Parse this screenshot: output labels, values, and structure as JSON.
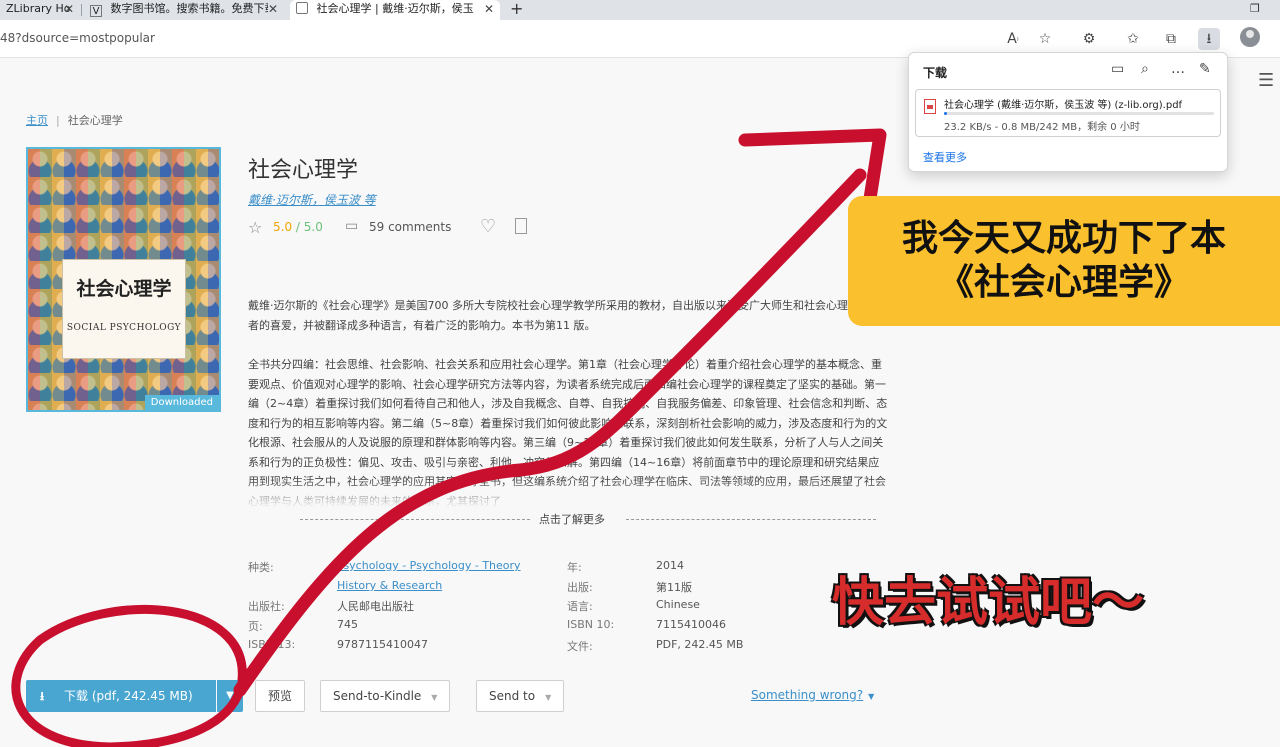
{
  "browser": {
    "tabs": [
      {
        "title": "ZLibrary Ho",
        "favicon": "z-icon"
      },
      {
        "title": "数字图书馆。搜索书籍。免费下载",
        "favicon": "v-icon"
      },
      {
        "title": "社会心理学 | 戴维·迈尔斯，侯玉",
        "favicon": "page-icon"
      }
    ],
    "address": "48?dsource=mostpopular",
    "icons": [
      "read-aloud-icon",
      "favorite-add-icon",
      "extensions-icon",
      "favorites-icon",
      "collections-icon",
      "download-icon",
      "profile-icon"
    ]
  },
  "downloads_panel": {
    "title": "下载",
    "file_name": "社会心理学 (戴维·迈尔斯，侯玉波 等) (z-lib.org).pdf",
    "status": "23.2 KB/s - 0.8 MB/242 MB，剩余 0 小时",
    "progress": 0.0035,
    "see_more": "查看更多"
  },
  "breadcrumb": {
    "home": "主页",
    "current": "社会心理学"
  },
  "cover": {
    "title_cn": "社会心理学",
    "title_en": "SOCIAL PSYCHOLOGY",
    "badge": "Downloaded"
  },
  "book": {
    "title": "社会心理学",
    "authors": "戴维·迈尔斯，侯玉波 等",
    "rating": "5.0",
    "rating_max": "/ 5.0",
    "comments": "59 comments",
    "description_p1": "戴维·迈尔斯的《社会心理学》是美国700 多所大专院校社会心理学教学所采用的教材，自出版以来深受广大师生和社会心理学爱好者的喜爱，并被翻译成多种语言，有着广泛的影响力。本书为第11 版。",
    "description_p2": "全书共分四编：社会思维、社会影响、社会关系和应用社会心理学。第1章（社会心理学导论）着重介绍社会心理学的基本概念、重要观点、价值观对心理学的影响、社会心理学研究方法等内容，为读者系统完成后面四编社会心理学的课程奠定了坚实的基础。第一编（2~4章）着重探讨我们如何看待自己和他人，涉及自我概念、自尊、自我控制、自我服务偏差、印象管理、社会信念和判断、态度和行为的相互影响等内容。第二编（5~8章）着重探讨我们如何彼此影响和联系，深刻剖析社会影响的威力，涉及态度和行为的文化根源、社会服从的人及说服的原理和群体影响等内容。第三编（9~13章）着重探讨我们彼此如何发生联系，分析了人与人之间关系和行为的正负极性：偏见、攻击、吸引与亲密、利他、冲突与和解。第四编（14~16章）将前面章节中的理论原理和研究结果应用到现实生活之中，社会心理学的应用其实贯穿全书，但这编系统介绍了社会心理学在临床、司法等领域的应用，最后还展望了社会心理学与人类可持续发展的未来的关系，尤其探讨了",
    "more": "点击了解更多"
  },
  "meta": {
    "category_label": "种类:",
    "category_1": "Psychology - Psychology - Theory",
    "category_2": "History & Research",
    "publisher_label": "出版社:",
    "publisher": "人民邮电出版社",
    "pages_label": "页:",
    "pages": "745",
    "isbn13_label": "ISBN 13:",
    "isbn13": "9787115410047",
    "year_label": "年:",
    "year": "2014",
    "edition_label": "出版:",
    "edition": "第11版",
    "language_label": "语言:",
    "language": "Chinese",
    "isbn10_label": "ISBN 10:",
    "isbn10": "7115410046",
    "file_label": "文件:",
    "file": "PDF, 242.45 MB"
  },
  "actions": {
    "download": "下载 (pdf, 242.45 MB)",
    "preview": "预览",
    "send_kindle": "Send-to-Kindle",
    "send_to": "Send to",
    "wrong": "Something wrong?"
  },
  "overlay": {
    "callout_line1": "我今天又成功下了本",
    "callout_line2": "《社会心理学》",
    "try_it": "快去试试吧～",
    "accent_red": "#c8102e",
    "callout_color": "#fbc02d"
  }
}
